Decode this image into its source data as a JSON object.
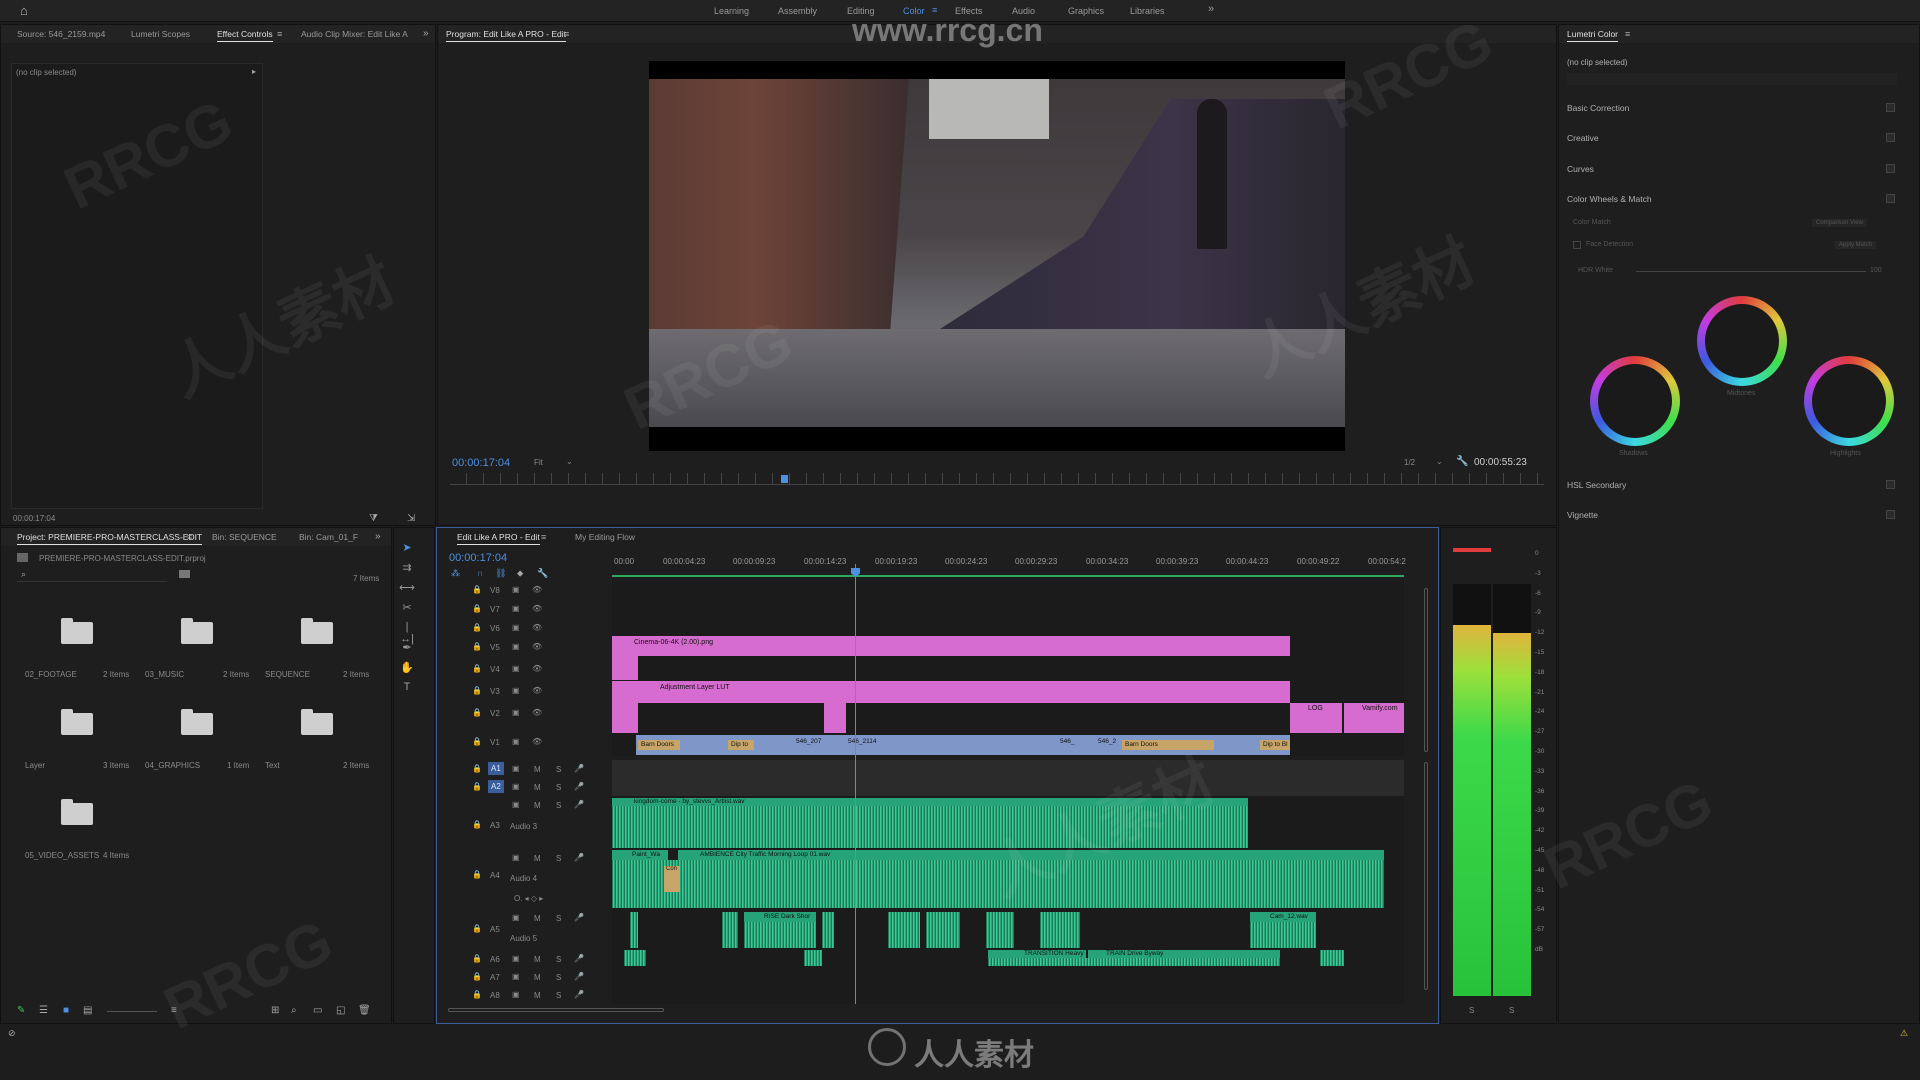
{
  "workspaces": [
    "Learning",
    "Assembly",
    "Editing",
    "Color",
    "Effects",
    "Audio",
    "Graphics",
    "Libraries"
  ],
  "active_workspace": "Color",
  "overflow": "»",
  "source_panel": {
    "tabs": [
      "Source: 546_2159.mp4",
      "Lumetri Scopes",
      "Effect Controls",
      "Audio Clip Mixer: Edit Like A"
    ],
    "active_tab": "Effect Controls",
    "status": "(no clip selected)",
    "timecode": "00:00:17:04"
  },
  "program": {
    "title": "Program: Edit Like A PRO - Edit",
    "timecode": "00:00:17:04",
    "fit": "Fit",
    "resolution": "1/2",
    "duration": "00:00:55:23",
    "playhead_fraction": 0.303
  },
  "project": {
    "tabs": [
      "Project: PREMIERE-PRO-MASTERCLASS-EDIT",
      "Bin: SEQUENCE",
      "Bin: Cam_01_F"
    ],
    "file": "PREMIERE-PRO-MASTERCLASS-EDIT.prproj",
    "count": "7 Items",
    "bins": [
      {
        "name": "02_FOOTAGE",
        "count": "2 Items"
      },
      {
        "name": "03_MUSIC",
        "count": "2 Items"
      },
      {
        "name": "SEQUENCE",
        "count": "2 Items"
      },
      {
        "name": "Layer",
        "count": "3 Items"
      },
      {
        "name": "04_GRAPHICS",
        "count": "1 Item"
      },
      {
        "name": "Text",
        "count": "2 Items"
      },
      {
        "name": "05_VIDEO_ASSETS",
        "count": "4 Items"
      }
    ]
  },
  "timeline": {
    "tabs": [
      "Edit Like A PRO - Edit",
      "My Editing Flow"
    ],
    "timecode": "00:00:17:04",
    "ruler": [
      "00:00",
      "00:00:04:23",
      "00:00:09:23",
      "00:00:14:23",
      "00:00:19:23",
      "00:00:24:23",
      "00:00:29:23",
      "00:00:34:23",
      "00:00:39:23",
      "00:00:44:23",
      "00:00:49:22",
      "00:00:54:2"
    ],
    "video_tracks": [
      "V8",
      "V7",
      "V6",
      "V5",
      "V4",
      "V3",
      "V2",
      "V1"
    ],
    "audio_tracks": [
      "A1",
      "A2",
      "A3",
      "A4",
      "A5",
      "A6",
      "A7",
      "A8"
    ],
    "audio_names": {
      "a3": "Audio 3",
      "a4": "Audio 4",
      "a5": "Audio 5"
    },
    "clips": {
      "cinema": "Cinema-06-4K (2.00).png",
      "adjustment": "Adjustment Layer LUT",
      "log": "LOG",
      "vamify": "Vamify.com",
      "barn1": "Barn Doors",
      "dipto1": "Dip to",
      "c546a": "546_207",
      "c546b": "546_2114",
      "c546c": "546_",
      "c546d": "546_2",
      "barn2": "Barn Doors",
      "dipto2": "Dip to Bl",
      "kingdom": "kingdom-come - by_stevvs_Artlist.wav",
      "paint": "Paint_Wa",
      "ambience": "AMBIENCE City Traffic Morning Loop 01.wav",
      "con": "Con",
      "rise": "RISE Dark Shor",
      "cam": "Cam_12.wav",
      "transition": "TRANSITION Heavy",
      "train": "TRAIN Drive Byway"
    }
  },
  "meter": {
    "db_labels": [
      "0",
      "-3",
      "-6",
      "-9",
      "-12",
      "-15",
      "-18",
      "-21",
      "-24",
      "-27",
      "-30",
      "-33",
      "-36",
      "-39",
      "-42",
      "-45",
      "-48",
      "-51",
      "-54",
      "-57",
      "dB"
    ],
    "solo": "S",
    "level_fraction": 0.9
  },
  "lumetri": {
    "title": "Lumetri Color",
    "status": "(no clip selected)",
    "sections": [
      "Basic Correction",
      "Creative",
      "Curves",
      "Color Wheels & Match",
      "HSL Secondary",
      "Vignette"
    ],
    "color_match": "Color Match",
    "comparison_view": "Comparison View",
    "face_detection": "Face Detection",
    "apply_match": "Apply Match",
    "hdr_white": "HDR White",
    "hdr_value": "100",
    "wheels": [
      "Midtones",
      "Shadows",
      "Highlights"
    ]
  },
  "watermarks": {
    "site": "www.rrcg.cn",
    "logo": "人人素材",
    "rrcg": "RRCG"
  },
  "colors": {
    "accent": "#4d8fe0",
    "video_clip": "#d66ccf",
    "sequence_clip": "#7e97c8",
    "audio_clip": "#27a379"
  }
}
